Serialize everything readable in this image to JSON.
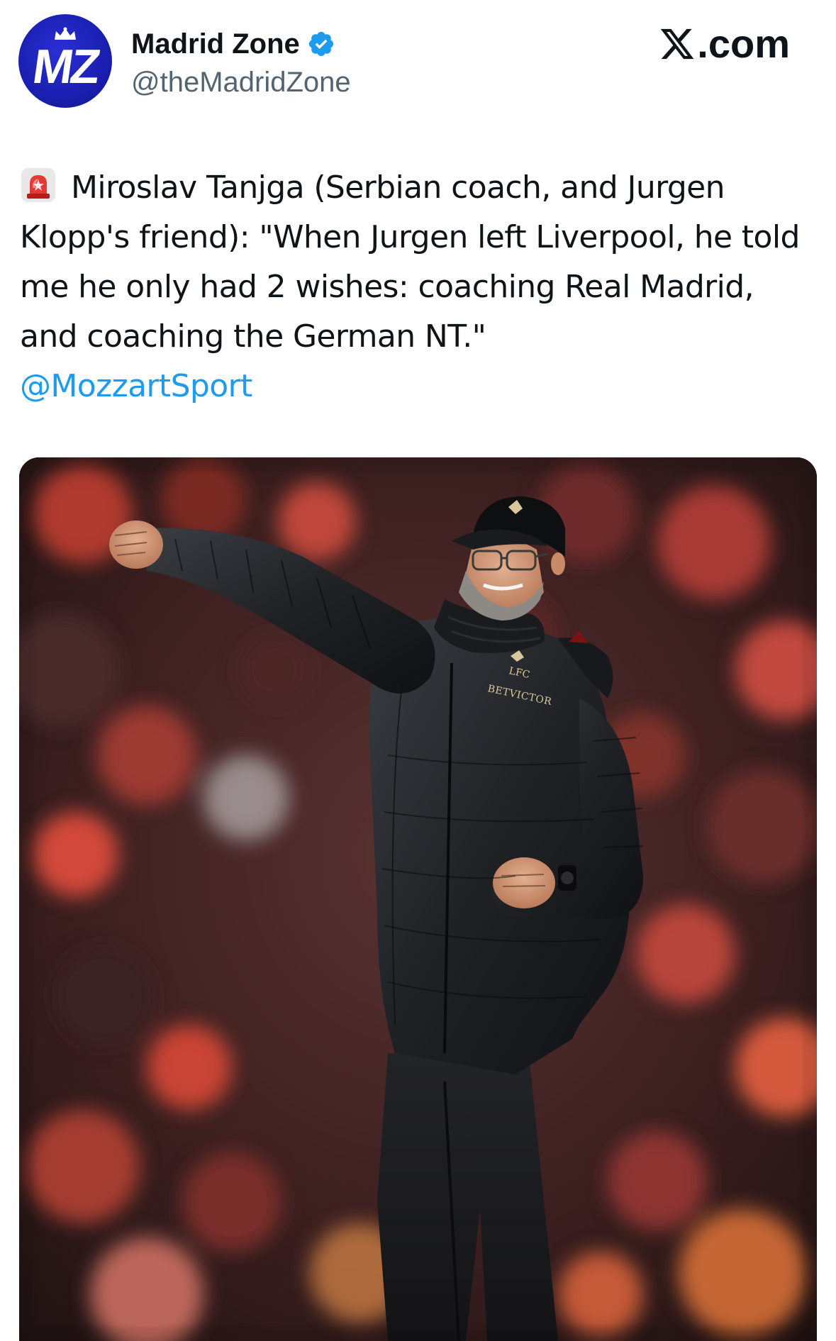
{
  "tweet": {
    "author": {
      "avatar_text": "MZ",
      "display_name": "Madrid Zone",
      "handle": "@theMadridZone",
      "verified_icon": "verified-badge-icon"
    },
    "brand": {
      "logo_icon": "x-logo-icon",
      "label": ".com"
    },
    "body": {
      "leading_icon": "police-light-emoji-icon",
      "text": "Miroslav Tanjga (Serbian coach, and Jurgen Klopp's friend): \"When Jurgen left Liverpool, he told me he only had 2 wishes: coaching Real Madrid, and coaching the German NT.\"",
      "mention": "@MozzartSport"
    },
    "media": {
      "jacket_text_1": "LFC",
      "jacket_text_2": "BETVICTOR"
    }
  },
  "colors": {
    "avatar_bg": "#1a1fb0",
    "verified": "#1d9bf0",
    "link": "#1d9bf0",
    "handle": "#536471",
    "text": "#0f1419"
  }
}
